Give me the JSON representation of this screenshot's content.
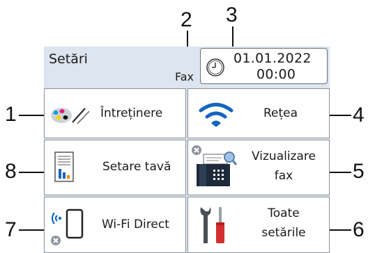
{
  "header": {
    "title": "Setări",
    "fax_label": "Fax",
    "date": "01.01.2022",
    "time": "00:00"
  },
  "tiles": [
    {
      "label": "Întreținere",
      "icon": "toner-icon"
    },
    {
      "label": "Rețea",
      "icon": "wifi-icon"
    },
    {
      "label": "Setare tavă",
      "icon": "tray-icon"
    },
    {
      "label": "Vizualizare",
      "label2": "fax",
      "icon": "fax-preview-icon"
    },
    {
      "label": "Wi-Fi Direct",
      "icon": "wifi-direct-icon"
    },
    {
      "label": "Toate",
      "label2": "setările",
      "icon": "tools-icon"
    }
  ],
  "callouts": [
    "1",
    "2",
    "3",
    "4",
    "5",
    "6",
    "7",
    "8"
  ],
  "colors": {
    "screen_bg": "#dde5ef",
    "wifi_blue": "#1565c0",
    "tile_bg": "#ffffff"
  }
}
